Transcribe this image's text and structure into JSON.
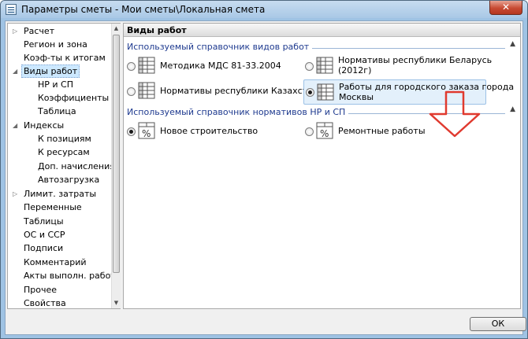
{
  "window": {
    "title": "Параметры сметы - Мои сметы\\Локальная смета",
    "close_label": "✕"
  },
  "tree": {
    "items": [
      {
        "label": "Расчет",
        "arrow": "▷"
      },
      {
        "label": "Регион и зона"
      },
      {
        "label": "Коэф-ты к итогам"
      },
      {
        "label": "Виды работ",
        "arrow": "◢",
        "selected": true
      },
      {
        "label": "НР и СП"
      },
      {
        "label": "Коэффициенты"
      },
      {
        "label": "Таблица"
      },
      {
        "label": "Индексы",
        "arrow": "◢"
      },
      {
        "label": "К позициям"
      },
      {
        "label": "К ресурсам"
      },
      {
        "label": "Доп. начисления"
      },
      {
        "label": "Автозагрузка"
      },
      {
        "label": "Лимит. затраты",
        "arrow": "▷"
      },
      {
        "label": "Переменные"
      },
      {
        "label": "Таблицы"
      },
      {
        "label": "ОС и ССР"
      },
      {
        "label": "Подписи"
      },
      {
        "label": "Комментарий"
      },
      {
        "label": "Акты выполн. работ"
      },
      {
        "label": "Прочее"
      },
      {
        "label": "Свойства"
      }
    ],
    "scroll_up": "▲",
    "scroll_down": "▼"
  },
  "panel": {
    "title": "Виды работ",
    "group1": {
      "title": "Используемый справочник видов работ",
      "toggle": "▲",
      "options": [
        {
          "label": "Методика МДС 81-33.2004",
          "checked": false
        },
        {
          "label_line1": "Нормативы республики Беларусь",
          "label_line2": "(2012г)",
          "checked": false
        },
        {
          "label": "Нормативы республики Казахстан",
          "checked": false
        },
        {
          "label_line1": "Работы для городского заказа города",
          "label_line2": "Москвы",
          "checked": true
        }
      ]
    },
    "group2": {
      "title": "Используемый справочник нормативов НР и СП",
      "toggle": "▲",
      "options": [
        {
          "label": "Новое строительство",
          "checked": true
        },
        {
          "label": "Ремонтные работы",
          "checked": false
        }
      ]
    }
  },
  "buttons": {
    "ok_label": "ОК"
  },
  "colors": {
    "annotation_arrow": "#e03a2f",
    "group_title": "#1e3a8f"
  },
  "icons": {
    "table": "table-icon",
    "percent_table": "percent-table-icon"
  }
}
